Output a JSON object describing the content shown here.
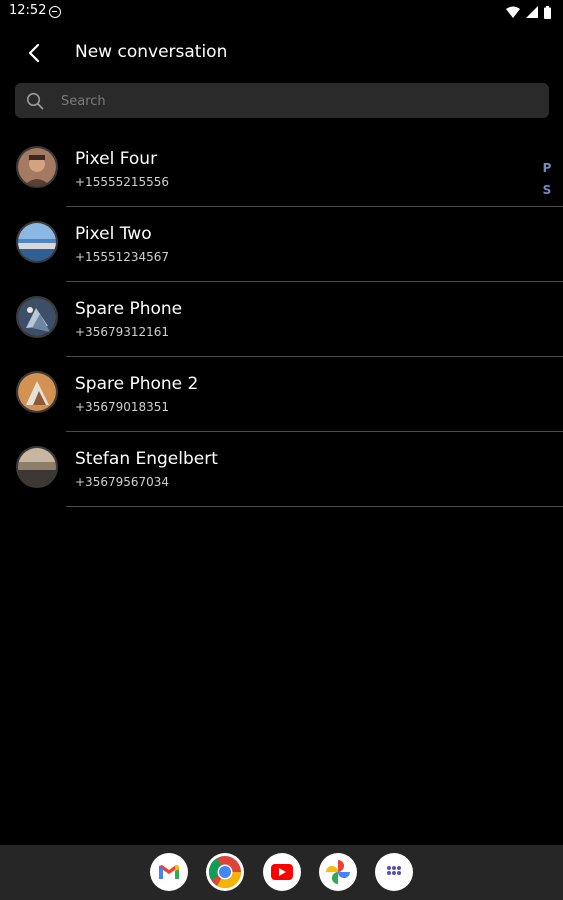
{
  "status_bar": {
    "time": "12:52"
  },
  "header": {
    "title": "New conversation"
  },
  "search": {
    "placeholder": "Search"
  },
  "contacts": [
    {
      "name": "Pixel Four",
      "phone": "+15555215556"
    },
    {
      "name": "Pixel Two",
      "phone": "+15551234567"
    },
    {
      "name": "Spare Phone",
      "phone": "+35679312161"
    },
    {
      "name": "Spare Phone 2",
      "phone": "+35679018351"
    },
    {
      "name": "Stefan Engelbert",
      "phone": "+35679567034"
    }
  ],
  "index": [
    "P",
    "S"
  ],
  "dock": {
    "apps": [
      "gmail-icon",
      "chrome-icon",
      "youtube-icon",
      "photos-icon",
      "app-drawer-icon"
    ]
  },
  "colors": {
    "background": "#000000",
    "search_bg": "#2a2a2a",
    "divider": "#4a4a4a",
    "index_letter": "#6f8cc6",
    "dock_bg": "#262626"
  }
}
